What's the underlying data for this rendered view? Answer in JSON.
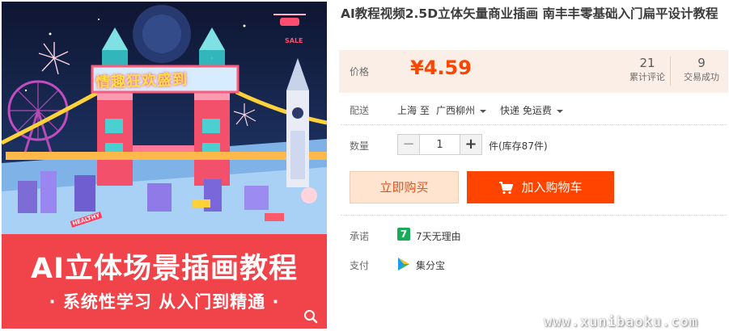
{
  "product_image": {
    "banner_title": "AI立体场景插画教程",
    "banner_subtitle": "· 系统性学习 从入门到精通 ·",
    "neon_sign_text": "情趣狂欢盛到",
    "sale_sign": "SALE",
    "street_sign": "HEALTHY",
    "zoom_icon": "magnifier-icon"
  },
  "title": "AI教程视频2.5D立体矢量商业插画 南丰丰零基础入门扁平设计教程",
  "price": {
    "label": "价格",
    "value": "¥4.59",
    "reviews_count": "21",
    "reviews_label": "累计评论",
    "deals_count": "9",
    "deals_label": "交易成功"
  },
  "shipping": {
    "label": "配送",
    "origin": "上海 至",
    "destination": "广西柳州",
    "method": "快递 免运费"
  },
  "quantity": {
    "label": "数量",
    "minus": "−",
    "plus": "+",
    "value": "1",
    "stock_text": "件(库存87件)"
  },
  "buttons": {
    "buy_now": "立即购买",
    "add_to_cart": "加入购物车"
  },
  "promise": {
    "label": "承诺",
    "badge": "7",
    "text": "7天无理由"
  },
  "payment": {
    "label": "支付",
    "text": "集分宝",
    "icon": "jifenbao-icon"
  },
  "watermark": "www.xunibaoku.com",
  "colors": {
    "price": "#ff4400",
    "price_bg": "#fbeee6",
    "cart_button": "#ff4400",
    "buy_button_bg": "#ffe4d0",
    "banner_red": "#f1444a",
    "promise_green": "#1aab58"
  }
}
